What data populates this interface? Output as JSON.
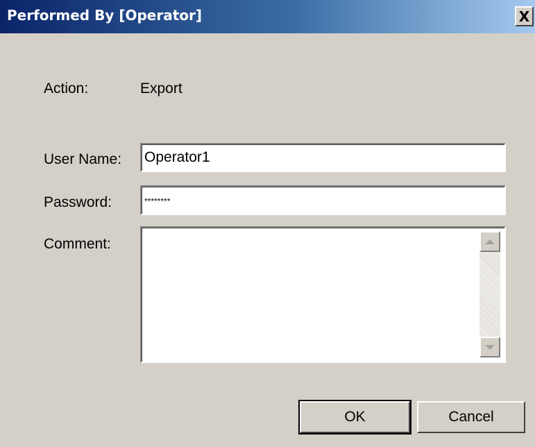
{
  "window": {
    "title": "Performed By [Operator]",
    "close_glyph": "X"
  },
  "form": {
    "action_label": "Action:",
    "action_value": "Export",
    "username_label": "User Name:",
    "username_value": "Operator1",
    "password_label": "Password:",
    "password_value": "********",
    "comment_label": "Comment:",
    "comment_value": ""
  },
  "buttons": {
    "ok": "OK",
    "cancel": "Cancel"
  },
  "colors": {
    "title_gradient_start": "#0a246a",
    "title_gradient_end": "#a6caf0",
    "dialog_background": "#d4d0c8"
  },
  "icons": [
    "close-icon",
    "scroll-up-arrow-icon",
    "scroll-down-arrow-icon"
  ]
}
